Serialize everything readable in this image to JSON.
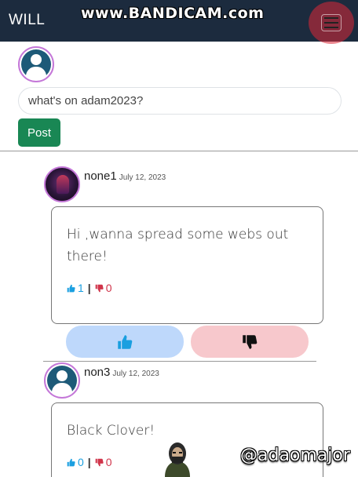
{
  "navbar": {
    "brand": "WILL",
    "watermark": "www.BANDICAM.com"
  },
  "composer": {
    "placeholder": "what's on adam2023?",
    "post_label": "Post"
  },
  "posts": [
    {
      "username": "none1",
      "date": "July 12, 2023",
      "text": "Hi ,wanna spread some webs out there!",
      "likes": "1",
      "dislikes": "0"
    },
    {
      "username": "non3",
      "date": "July 12, 2023",
      "text": "Black Clover!",
      "likes": "0",
      "dislikes": "0"
    }
  ],
  "overlay": {
    "handle": "@adaomajor"
  },
  "colors": {
    "navbar": "#1c2b3e",
    "post_button": "#198754",
    "like": "#bed8fb",
    "dislike": "#f7c8cc",
    "up": "#1a9fe0",
    "down": "#d0344a",
    "avatar_border": "#c477d8"
  }
}
